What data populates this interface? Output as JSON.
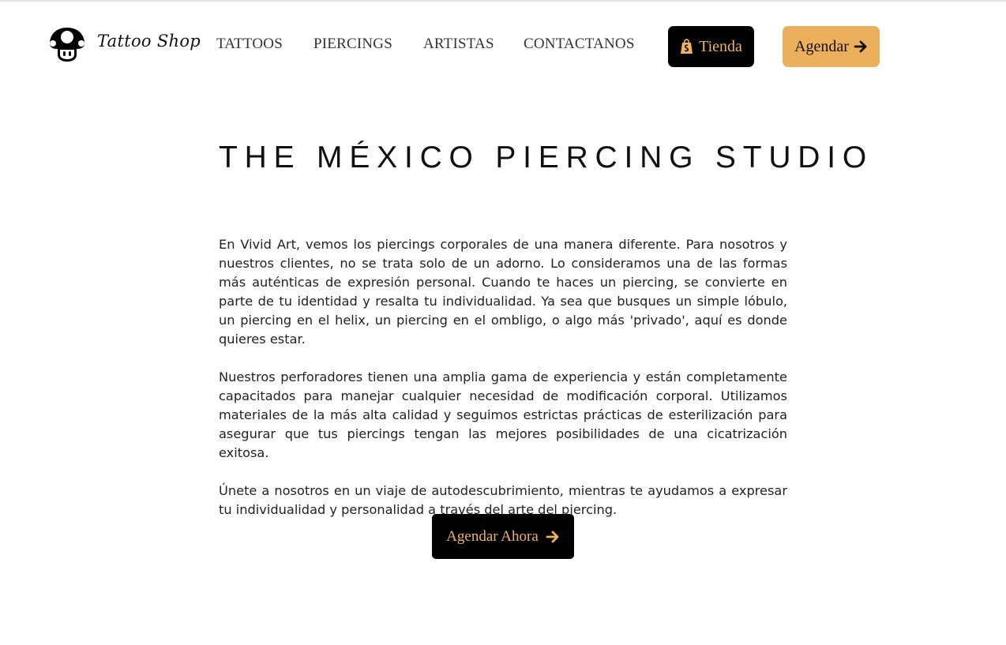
{
  "header": {
    "brand_name": "Tattoo Shop",
    "logo_icon": "mushroom-logo-icon",
    "nav": [
      {
        "label": "TATTOOS"
      },
      {
        "label": "PIERCINGS"
      },
      {
        "label": "ARTISTAS"
      },
      {
        "label": "CONTACTANOS"
      }
    ],
    "store_button": {
      "label": "Tienda",
      "icon": "shopping-bag-icon"
    },
    "book_button": {
      "label": "Agendar",
      "icon": "arrow-right-icon"
    }
  },
  "main": {
    "title": "THE MÉXICO PIERCING STUDIO",
    "paragraphs": [
      "En Vivid Art, vemos los piercings corporales de una manera diferente. Para nosotros y nuestros clientes, no se trata solo de un adorno. Lo consideramos una de las formas más auténticas de expresión personal. Cuando te haces un piercing, se convierte en parte de tu identidad y resalta tu individualidad. Ya sea que busques un simple lóbulo, un piercing en el helix, un piercing en el ombligo, o algo más 'privado', aquí es donde quieres estar.",
      "Nuestros perforadores tienen una amplia gama de experiencia y están completamente capacitados para manejar cualquier necesidad de modificación corporal. Utilizamos materiales de la más alta calidad y seguimos estrictas prácticas de esterilización para asegurar que tus piercings tengan las mejores posibilidades de una cicatrización exitosa.",
      "Únete a nosotros en un viaje de autodescubrimiento, mientras te ayudamos a expresar tu individualidad y personalidad a través del arte del piercing."
    ],
    "cta_button": {
      "label": "Agendar Ahora",
      "icon": "arrow-right-icon"
    }
  },
  "colors": {
    "accent": "#ecb05c",
    "accent_text": "#f0b25c",
    "dark": "#000000",
    "background": "#ffffff"
  }
}
